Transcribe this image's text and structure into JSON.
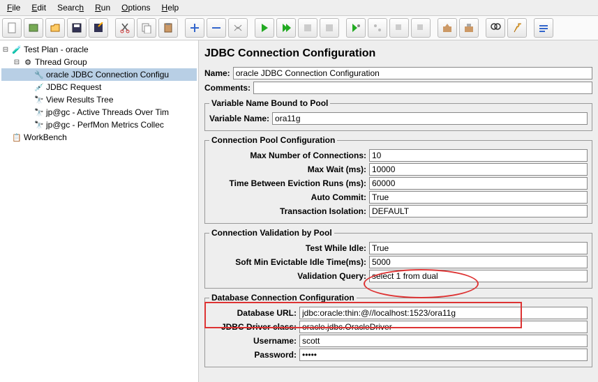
{
  "menu": {
    "file": "File",
    "edit": "Edit",
    "search": "Search",
    "run": "Run",
    "options": "Options",
    "help": "Help"
  },
  "tree": {
    "root": "Test Plan - oracle",
    "group": "Thread Group",
    "items": [
      "oracle JDBC Connection Configu",
      "JDBC Request",
      "View Results Tree",
      "jp@gc - Active Threads Over Tim",
      "jp@gc - PerfMon Metrics Collec"
    ],
    "workbench": "WorkBench"
  },
  "header": "JDBC Connection Configuration",
  "name_label": "Name:",
  "name_value": "oracle JDBC Connection Configuration",
  "comments_label": "Comments:",
  "comments_value": "",
  "var_pool": {
    "legend": "Variable Name Bound to Pool",
    "label": "Variable Name:",
    "value": "ora11g"
  },
  "conn_pool": {
    "legend": "Connection Pool Configuration",
    "max_conn": {
      "label": "Max Number of Connections:",
      "value": "10"
    },
    "max_wait": {
      "label": "Max Wait (ms):",
      "value": "10000"
    },
    "evict": {
      "label": "Time Between Eviction Runs (ms):",
      "value": "60000"
    },
    "auto_commit": {
      "label": "Auto Commit:",
      "value": "True"
    },
    "tx_iso": {
      "label": "Transaction Isolation:",
      "value": "DEFAULT"
    }
  },
  "validation": {
    "legend": "Connection Validation by Pool",
    "test_idle": {
      "label": "Test While Idle:",
      "value": "True"
    },
    "soft_min": {
      "label": "Soft Min Evictable Idle Time(ms):",
      "value": "5000"
    },
    "query": {
      "label": "Validation Query:",
      "value": "select 1 from dual"
    }
  },
  "db": {
    "legend": "Database Connection Configuration",
    "url": {
      "label": "Database URL:",
      "value": "jdbc:oracle:thin:@//localhost:1523/ora11g"
    },
    "driver": {
      "label": "JDBC Driver class:",
      "value": "oracle.jdbc.OracleDriver"
    },
    "user": {
      "label": "Username:",
      "value": "scott"
    },
    "pass": {
      "label": "Password:",
      "value": "•••••"
    }
  }
}
